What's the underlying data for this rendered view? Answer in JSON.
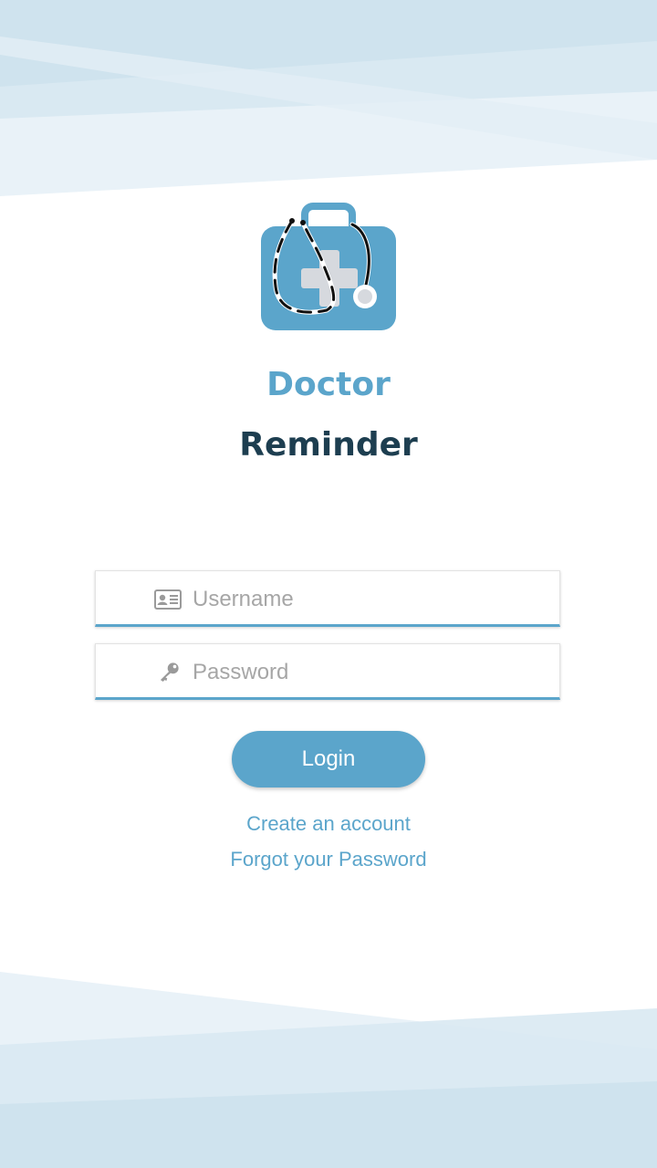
{
  "brand": {
    "line1": "Doctor",
    "line2": "Reminder"
  },
  "form": {
    "username_placeholder": "Username",
    "password_placeholder": "Password",
    "username_icon": "id-card-icon",
    "password_icon": "key-icon"
  },
  "actions": {
    "login_label": "Login",
    "create_account": "Create an account",
    "forgot_password": "Forgot your Password"
  },
  "colors": {
    "accent": "#5ba5cb",
    "dark_text": "#1d3e50",
    "placeholder": "#a6a6a6",
    "background_bands": "#cfe3ee"
  }
}
